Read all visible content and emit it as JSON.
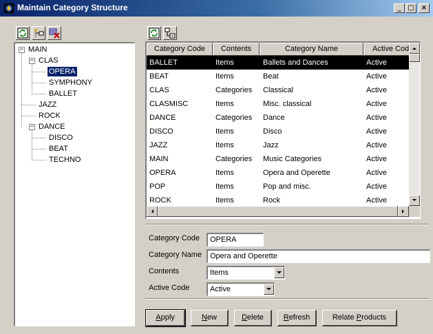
{
  "window": {
    "title": "Maintain Category Structure",
    "controls": {
      "minimize": "_",
      "maximize": "□",
      "close": "×"
    }
  },
  "tree_toolbar": [
    "refresh-icon",
    "add-node-icon",
    "delete-node-icon"
  ],
  "grid_toolbar": [
    "refresh-icon",
    "tree-view-icon"
  ],
  "tree": {
    "expander_expanded": "−",
    "nodes": [
      {
        "label": "MAIN",
        "expanded": true
      },
      {
        "label": "CLAS",
        "expanded": true
      },
      {
        "label": "OPERA",
        "selected": true
      },
      {
        "label": "SYMPHONY"
      },
      {
        "label": "BALLET"
      },
      {
        "label": "JAZZ"
      },
      {
        "label": "ROCK"
      },
      {
        "label": "DANCE",
        "expanded": true
      },
      {
        "label": "DISCO"
      },
      {
        "label": "BEAT"
      },
      {
        "label": "TECHNO"
      }
    ]
  },
  "grid": {
    "columns": [
      "Category Code",
      "Contents",
      "Category Name",
      "Active Cod"
    ],
    "rows": [
      [
        "BALLET",
        "Items",
        "Ballets and Dances",
        "Active"
      ],
      [
        "BEAT",
        "Items",
        "Beat",
        "Active"
      ],
      [
        "CLAS",
        "Categories",
        "Classical",
        "Active"
      ],
      [
        "CLASMISC",
        "Items",
        "Misc. classical",
        "Active"
      ],
      [
        "DANCE",
        "Categories",
        "Dance",
        "Active"
      ],
      [
        "DISCO",
        "Items",
        "Disco",
        "Active"
      ],
      [
        "JAZZ",
        "Items",
        "Jazz",
        "Active"
      ],
      [
        "MAIN",
        "Categories",
        "Music Categories",
        "Active"
      ],
      [
        "OPERA",
        "Items",
        "Opera and Operette",
        "Active"
      ],
      [
        "POP",
        "Items",
        "Pop and misc.",
        "Active"
      ],
      [
        "ROCK",
        "Items",
        "Rock",
        "Active"
      ]
    ],
    "selected_row": 0
  },
  "form": {
    "category_code": {
      "label": "Category Code",
      "value": "OPERA"
    },
    "category_name": {
      "label": "Category Name",
      "value": "Opera and Operette"
    },
    "contents": {
      "label": "Contents",
      "value": "Items"
    },
    "active_code": {
      "label": "Active Code",
      "value": "Active"
    }
  },
  "buttons": {
    "apply": {
      "pre": "",
      "key": "A",
      "post": "pply"
    },
    "new": {
      "pre": "",
      "key": "N",
      "post": "ew"
    },
    "delete": {
      "pre": "",
      "key": "D",
      "post": "elete"
    },
    "refresh": {
      "pre": "",
      "key": "R",
      "post": "efresh"
    },
    "relate": {
      "pre": "Relate ",
      "key": "P",
      "post": "roducts"
    }
  },
  "colors": {
    "selection": "#0a246a",
    "grid_selection": "#000000",
    "face": "#d4d0c8"
  }
}
